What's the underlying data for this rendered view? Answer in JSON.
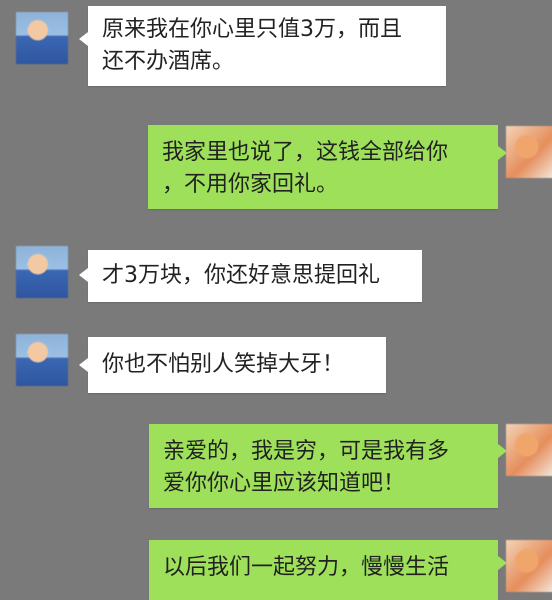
{
  "messages": [
    {
      "side": "left",
      "line1": "原来我在你心里只值3万，而且",
      "line2": "还不办酒席。"
    },
    {
      "side": "right",
      "line1": "我家里也说了，这钱全部给你",
      "line2": "，不用你家回礼。"
    },
    {
      "side": "left",
      "line1": "才3万块，你还好意思提回礼"
    },
    {
      "side": "left",
      "line1": "你也不怕别人笑掉大牙！"
    },
    {
      "side": "right",
      "line1": "亲爱的，我是穷，可是我有多",
      "line2": "爱你你心里应该知道吧！"
    },
    {
      "side": "right",
      "line1": "以后我们一起努力，慢慢生活"
    }
  ],
  "colors": {
    "background": "#7a7a7a",
    "incoming_bubble": "#ffffff",
    "outgoing_bubble": "#9ee05a"
  }
}
